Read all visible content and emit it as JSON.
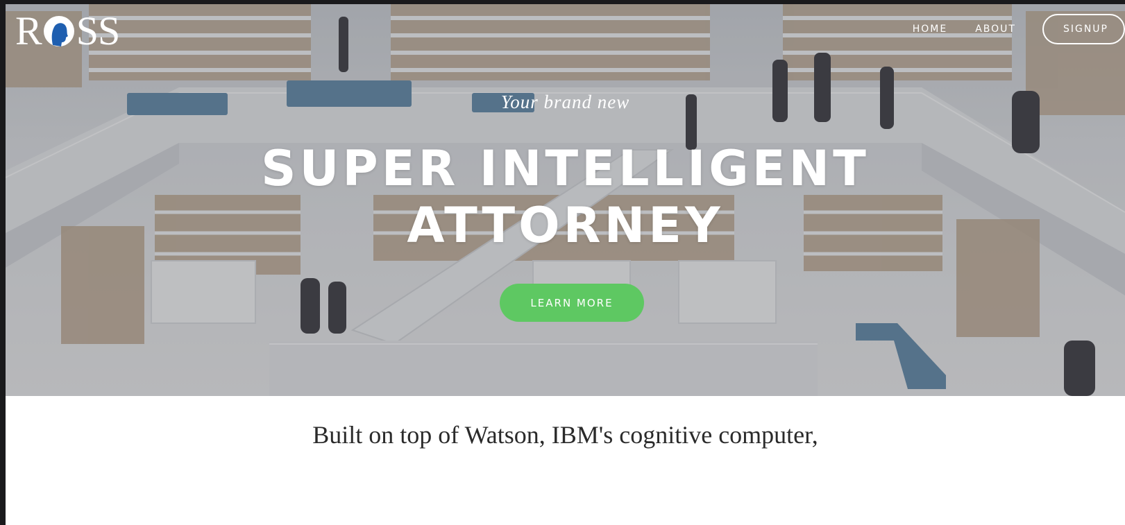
{
  "brand": {
    "logo_text_left": "R",
    "logo_text_right": "SS",
    "logo_alt": "ROSS"
  },
  "nav": {
    "items": [
      {
        "label": "HOME"
      },
      {
        "label": "ABOUT"
      }
    ],
    "signup_label": "SIGNUP"
  },
  "hero": {
    "tagline": "Your brand new",
    "headline_line1": "SUPER INTELLIGENT",
    "headline_line2": "ATTORNEY",
    "cta_label": "LEARN MORE",
    "cta_color": "#5ec862"
  },
  "intro": {
    "text": "Built on top of Watson, IBM's cognitive computer,"
  }
}
